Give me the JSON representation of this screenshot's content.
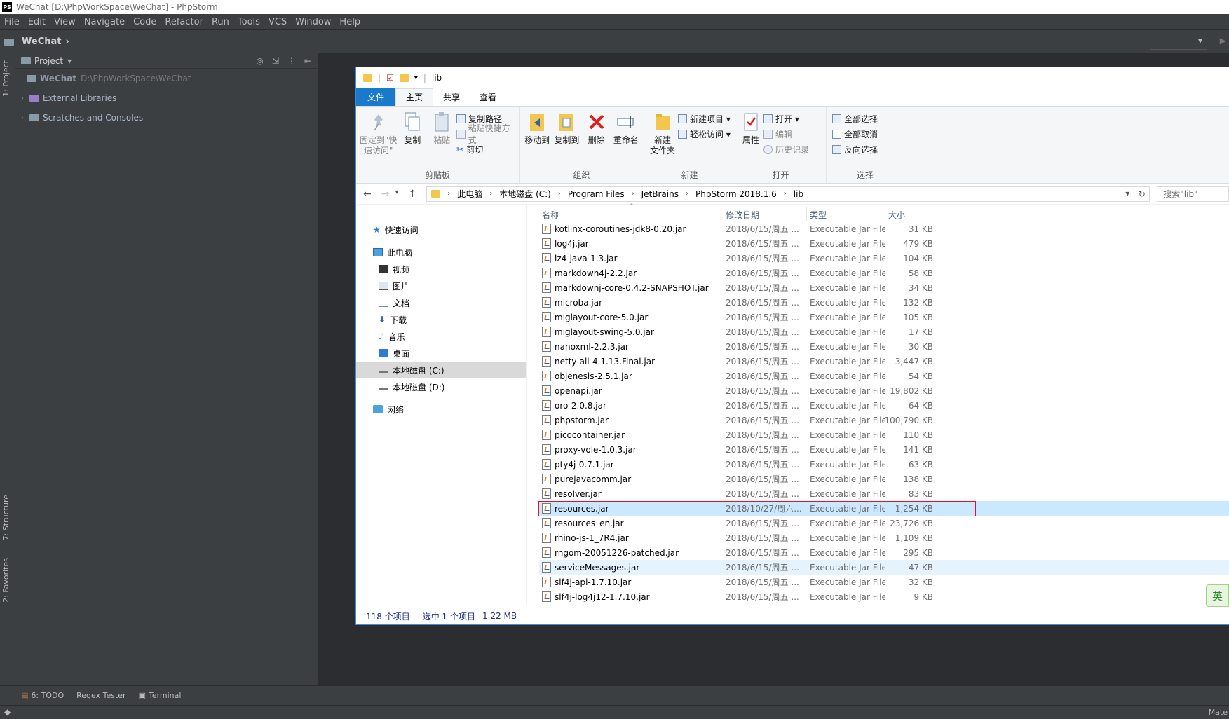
{
  "ide": {
    "title": "WeChat [D:\\PhpWorkSpace\\WeChat] - PhpStorm",
    "logo": "PS",
    "menu": [
      "File",
      "Edit",
      "View",
      "Navigate",
      "Code",
      "Refactor",
      "Run",
      "Tools",
      "VCS",
      "Window",
      "Help"
    ],
    "nav_crumb": "WeChat",
    "project_header": "Project",
    "tree": [
      {
        "label": "WeChat",
        "path": "D:\\PhpWorkSpace\\WeChat"
      },
      {
        "label": "External Libraries"
      },
      {
        "label": "Scratches and Consoles"
      }
    ],
    "left_tabs": {
      "project": "1: Project",
      "structure": "7: Structure",
      "favorites": "2: Favorites"
    },
    "bottom_tabs": [
      "6: TODO",
      "Regex Tester",
      "Terminal"
    ],
    "status_right": "Mate"
  },
  "explorer": {
    "title": "lib",
    "tabs": {
      "file": "文件",
      "home": "主页",
      "share": "共享",
      "view": "查看"
    },
    "ribbon": {
      "clipboard": {
        "pin": "固定到\"快\n速访问\"",
        "copy": "复制",
        "paste": "粘贴",
        "copy_path": "复制路径",
        "paste_shortcut": "粘贴快捷方式",
        "cut": "剪切",
        "label": "剪贴板"
      },
      "organize": {
        "move_to": "移动到",
        "copy_to": "复制到",
        "delete": "删除",
        "rename": "重命名",
        "label": "组织"
      },
      "new": {
        "new_folder": "新建\n文件夹",
        "new_item": "新建项目 ▾",
        "easy_access": "轻松访问 ▾",
        "label": "新建"
      },
      "open": {
        "properties": "属性",
        "open": "打开 ▾",
        "edit": "编辑",
        "history": "历史记录",
        "label": "打开"
      },
      "select": {
        "select_all": "全部选择",
        "select_none": "全部取消",
        "invert": "反向选择",
        "label": "选择"
      }
    },
    "breadcrumb": [
      "此电脑",
      "本地磁盘 (C:)",
      "Program Files",
      "JetBrains",
      "PhpStorm 2018.1.6",
      "lib"
    ],
    "search_placeholder": "搜索\"lib\"",
    "nav_pane": {
      "quick_access": "快速访问",
      "this_pc": "此电脑",
      "videos": "视频",
      "pictures": "图片",
      "documents": "文档",
      "downloads": "下载",
      "music": "音乐",
      "desktop": "桌面",
      "drive_c": "本地磁盘 (C:)",
      "drive_d": "本地磁盘 (D:)",
      "network": "网络"
    },
    "columns": {
      "name": "名称",
      "date": "修改日期",
      "type": "类型",
      "size": "大小"
    },
    "files": [
      {
        "name": "kotlinx-coroutines-jdk8-0.20.jar",
        "date": "2018/6/15/周五 ...",
        "type": "Executable Jar File",
        "size": "31 KB"
      },
      {
        "name": "log4j.jar",
        "date": "2018/6/15/周五 ...",
        "type": "Executable Jar File",
        "size": "479 KB"
      },
      {
        "name": "lz4-java-1.3.jar",
        "date": "2018/6/15/周五 ...",
        "type": "Executable Jar File",
        "size": "104 KB"
      },
      {
        "name": "markdown4j-2.2.jar",
        "date": "2018/6/15/周五 ...",
        "type": "Executable Jar File",
        "size": "58 KB"
      },
      {
        "name": "markdownj-core-0.4.2-SNAPSHOT.jar",
        "date": "2018/6/15/周五 ...",
        "type": "Executable Jar File",
        "size": "34 KB"
      },
      {
        "name": "microba.jar",
        "date": "2018/6/15/周五 ...",
        "type": "Executable Jar File",
        "size": "132 KB"
      },
      {
        "name": "miglayout-core-5.0.jar",
        "date": "2018/6/15/周五 ...",
        "type": "Executable Jar File",
        "size": "105 KB"
      },
      {
        "name": "miglayout-swing-5.0.jar",
        "date": "2018/6/15/周五 ...",
        "type": "Executable Jar File",
        "size": "17 KB"
      },
      {
        "name": "nanoxml-2.2.3.jar",
        "date": "2018/6/15/周五 ...",
        "type": "Executable Jar File",
        "size": "30 KB"
      },
      {
        "name": "netty-all-4.1.13.Final.jar",
        "date": "2018/6/15/周五 ...",
        "type": "Executable Jar File",
        "size": "3,447 KB"
      },
      {
        "name": "objenesis-2.5.1.jar",
        "date": "2018/6/15/周五 ...",
        "type": "Executable Jar File",
        "size": "54 KB"
      },
      {
        "name": "openapi.jar",
        "date": "2018/6/15/周五 ...",
        "type": "Executable Jar File",
        "size": "19,802 KB"
      },
      {
        "name": "oro-2.0.8.jar",
        "date": "2018/6/15/周五 ...",
        "type": "Executable Jar File",
        "size": "64 KB"
      },
      {
        "name": "phpstorm.jar",
        "date": "2018/6/15/周五 ...",
        "type": "Executable Jar File",
        "size": "100,790 KB"
      },
      {
        "name": "picocontainer.jar",
        "date": "2018/6/15/周五 ...",
        "type": "Executable Jar File",
        "size": "110 KB"
      },
      {
        "name": "proxy-vole-1.0.3.jar",
        "date": "2018/6/15/周五 ...",
        "type": "Executable Jar File",
        "size": "141 KB"
      },
      {
        "name": "pty4j-0.7.1.jar",
        "date": "2018/6/15/周五 ...",
        "type": "Executable Jar File",
        "size": "63 KB"
      },
      {
        "name": "purejavacomm.jar",
        "date": "2018/6/15/周五 ...",
        "type": "Executable Jar File",
        "size": "138 KB"
      },
      {
        "name": "resolver.jar",
        "date": "2018/6/15/周五 ...",
        "type": "Executable Jar File",
        "size": "83 KB"
      },
      {
        "name": "resources.jar",
        "date": "2018/10/27/周六...",
        "type": "Executable Jar File",
        "size": "1,254 KB",
        "state": "selected"
      },
      {
        "name": "resources_en.jar",
        "date": "2018/6/15/周五 ...",
        "type": "Executable Jar File",
        "size": "23,726 KB"
      },
      {
        "name": "rhino-js-1_7R4.jar",
        "date": "2018/6/15/周五 ...",
        "type": "Executable Jar File",
        "size": "1,109 KB"
      },
      {
        "name": "rngom-20051226-patched.jar",
        "date": "2018/6/15/周五 ...",
        "type": "Executable Jar File",
        "size": "295 KB"
      },
      {
        "name": "serviceMessages.jar",
        "date": "2018/6/15/周五 ...",
        "type": "Executable Jar File",
        "size": "47 KB",
        "state": "hover"
      },
      {
        "name": "slf4j-api-1.7.10.jar",
        "date": "2018/6/15/周五 ...",
        "type": "Executable Jar File",
        "size": "32 KB"
      },
      {
        "name": "slf4j-log4j12-1.7.10.jar",
        "date": "2018/6/15/周五 ...",
        "type": "Executable Jar File",
        "size": "9 KB"
      }
    ],
    "status": {
      "count": "118 个项目",
      "selection": "选中 1 个项目",
      "size": "1.22 MB"
    }
  },
  "ime": "英",
  "colors": {
    "ide_bg": "#2b2d30",
    "ide_panel": "#3c3f41",
    "accent": "#1979ca",
    "selection": "#cce8ff",
    "highlight_border": "#e81123"
  }
}
